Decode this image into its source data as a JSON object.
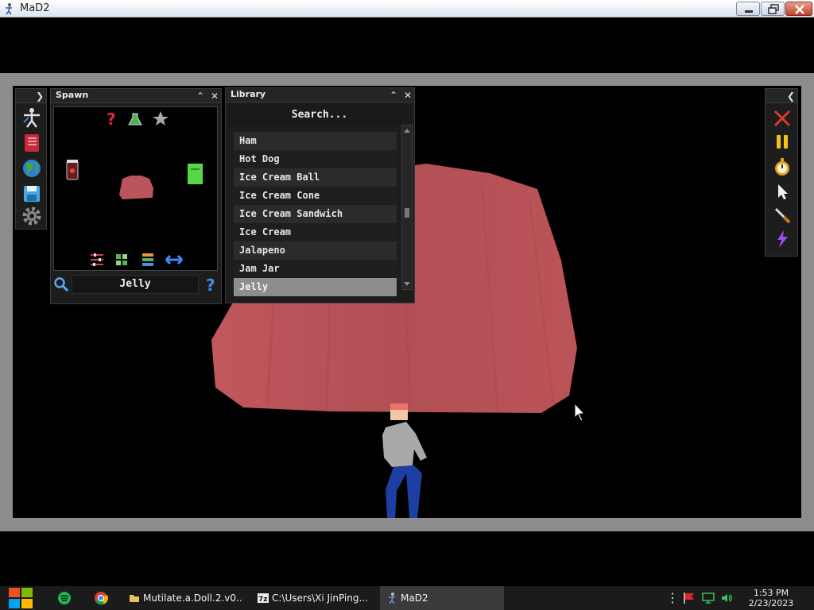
{
  "window": {
    "title": "MaD2"
  },
  "left_dock": {
    "items": [
      "ragdoll-icon",
      "notebook-icon",
      "globe-icon",
      "save-icon",
      "settings-gear-icon"
    ]
  },
  "spawn": {
    "title": "Spawn",
    "search_value": "Jelly",
    "top_icons": [
      "question-icon",
      "flask-icon",
      "star-icon"
    ],
    "bottom_icons": [
      "sliders-icon",
      "grid-icon",
      "list-icon",
      "swap-arrows-icon"
    ]
  },
  "library": {
    "title": "Library",
    "search_placeholder": "Search...",
    "items": [
      "Ham",
      "Hot Dog",
      "Ice Cream Ball",
      "Ice Cream Cone",
      "Ice Cream Sandwich",
      "Ice Cream",
      "Jalapeno",
      "Jam Jar",
      "Jelly"
    ],
    "selected": "Jelly"
  },
  "right_toolbar": {
    "items": [
      "close-x-icon",
      "pause-icon",
      "stopwatch-icon",
      "cursor-icon",
      "knife-icon",
      "lightning-icon"
    ]
  },
  "colors": {
    "jelly": "#b9555b",
    "panel_bg": "#1d1d1d",
    "selected_row": "#8d8d8d",
    "doll_shirt": "#a9a9a9",
    "doll_pants": "#1d3fa3",
    "doll_head": "#f4c6a2"
  },
  "taskbar": {
    "tasks": [
      {
        "label": "Mutilate.a.Doll.2.v0...."
      },
      {
        "label": "C:\\Users\\Xi JinPing..."
      },
      {
        "label": "MaD2"
      }
    ],
    "time": "1:53 PM",
    "date": "2/23/2023"
  }
}
